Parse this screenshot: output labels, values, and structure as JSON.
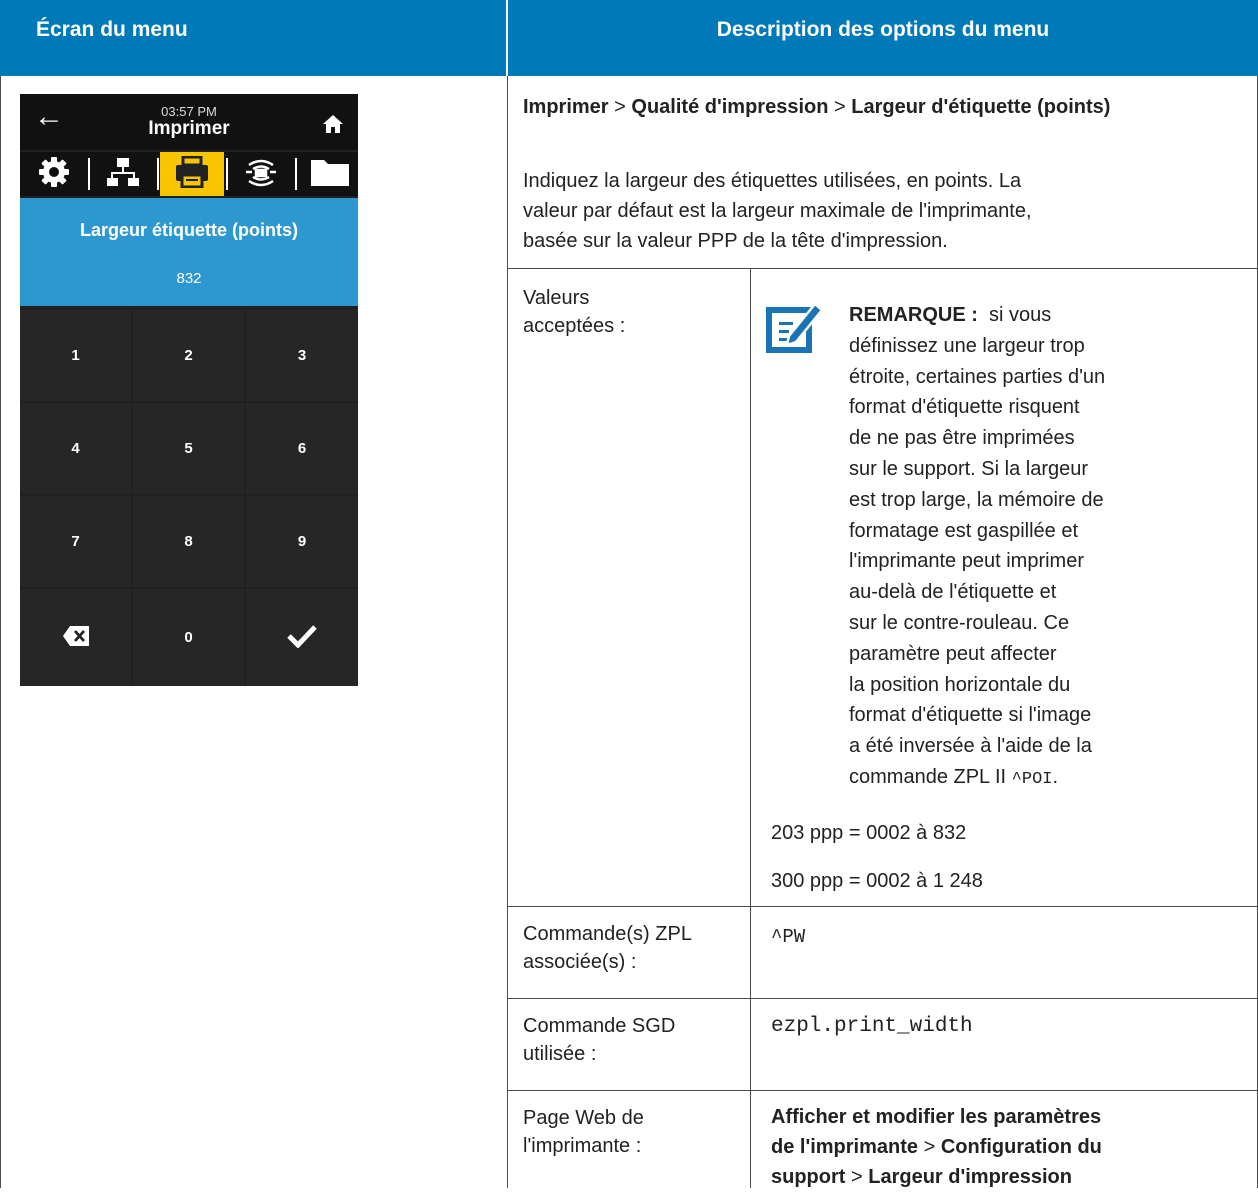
{
  "header": {
    "left": "Écran du menu",
    "right": "Description des options du menu"
  },
  "device": {
    "time": "03:57 PM",
    "title": "Imprimer",
    "icons": {
      "back": "back-arrow-icon",
      "home": "home-icon"
    },
    "tabs": [
      "gear-icon",
      "network-icon",
      "printer-icon",
      "rfid-icon",
      "folder-icon"
    ],
    "selected_tab": 2,
    "colors": {
      "accent": "#2d98d0",
      "selected_tab": "#f7c600",
      "background": "#202020"
    },
    "setting_label": "Largeur étiquette (points)",
    "setting_value": "832",
    "keys": [
      "1",
      "2",
      "3",
      "4",
      "5",
      "6",
      "7",
      "8",
      "9",
      "",
      "0",
      ""
    ],
    "key_icons": {
      "delete": "backspace-icon",
      "confirm": "checkmark-icon"
    }
  },
  "description": {
    "path": {
      "part1": "Imprimer",
      "sep1": ">",
      "part2": "Qualité d'impression",
      "sep2": ">",
      "part3": "Largeur d'étiquette (points)"
    },
    "intro_lines": [
      "Indiquez la largeur des étiquettes utilisées, en points. La",
      "valeur par défaut est la largeur maximale de l'imprimante,",
      "basée sur la valeur PPP de la tête d'impression."
    ]
  },
  "rows": {
    "accepted": {
      "label_lines": [
        "Valeurs",
        "acceptées :"
      ],
      "note_label": "REMARQUE :",
      "note_lines": [
        "si vous",
        "définissez une largeur trop",
        "étroite, certaines parties d'un",
        "format d'étiquette risquent",
        "de ne pas être imprimées",
        "sur le support. Si la largeur",
        "est trop large, la mémoire de",
        "formatage est gaspillée et",
        "l'imprimante peut imprimer",
        "au-delà de l'étiquette et",
        "sur le contre-rouleau. Ce",
        "paramètre peut affecter",
        "la position horizontale du",
        "format d'étiquette si l'image",
        "a été inversée à l'aide de la"
      ],
      "note_last_prefix": "commande ZPL II",
      "note_last_code": "^POI",
      "note_last_suffix": ".",
      "values": [
        "203 ppp = 0002 à 832",
        "300 ppp = 0002 à 1 248"
      ]
    },
    "zpl": {
      "label_lines": [
        "Commande(s) ZPL",
        "associée(s) :"
      ],
      "value": "^PW"
    },
    "sgd": {
      "label_lines": [
        "Commande SGD",
        "utilisée :"
      ],
      "value": "ezpl.print_width"
    },
    "web": {
      "label_lines": [
        "Page Web de",
        "l'imprimante :"
      ],
      "line1": "Afficher et modifier les paramètres",
      "line2_a": "de l'imprimante",
      "line2_sep": ">",
      "line2_b": "Configuration du",
      "line3_a": "support",
      "line3_sep": ">",
      "line3_b": "Largeur d'impression"
    }
  }
}
